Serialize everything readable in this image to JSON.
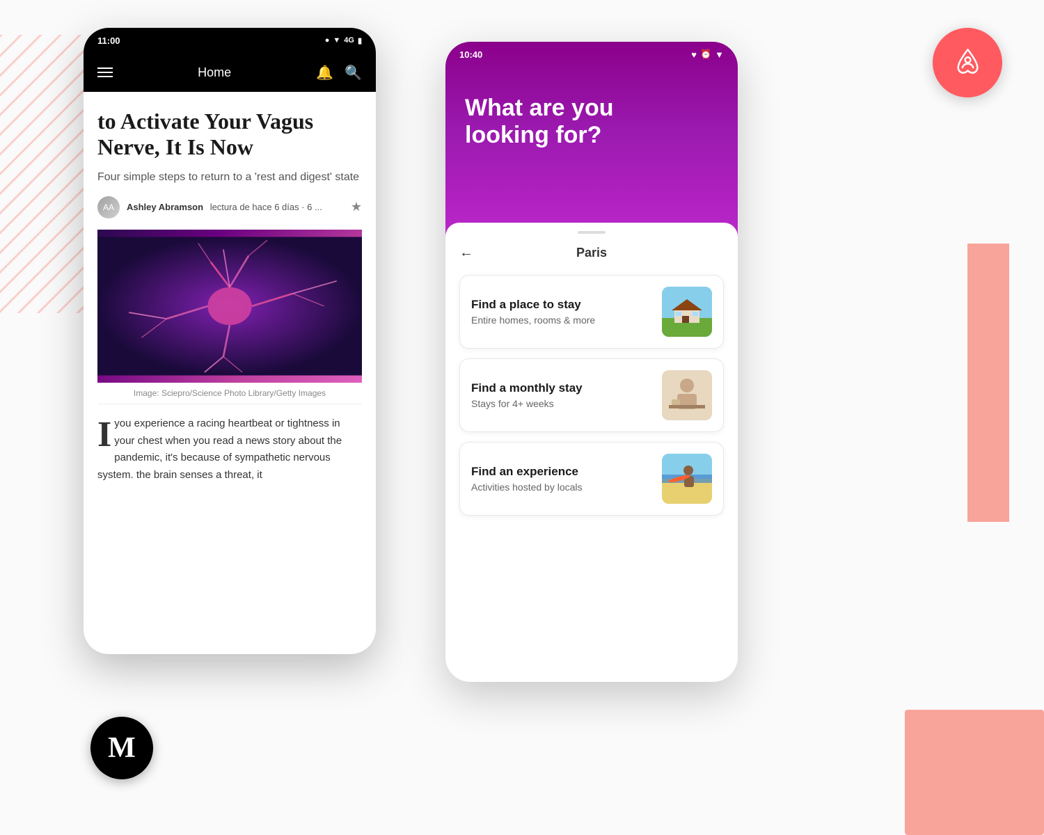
{
  "page": {
    "background_color": "#fafafa"
  },
  "medium_app": {
    "status_bar": {
      "time": "11:00",
      "icons": "● ▼ 4G ▲ 🔋"
    },
    "nav": {
      "title": "Home",
      "hamburger_icon": "menu-icon",
      "bell_icon": "notification-icon",
      "search_icon": "search-icon"
    },
    "article": {
      "title": "to Activate Your Vagus Nerve, It Is Now",
      "subtitle": "Four simple steps to return to a 'rest and digest' state",
      "author_name": "Ashley Abramson",
      "author_meta": "lectura de hace 6 días · 6 ...",
      "image_caption": "Image: Sciepro/Science Photo Library/Getty Images",
      "body_text": "you experience a racing heartbeat or tightness in your chest when you read a news story about the pandemic, it's because of sympathetic nervous system. the brain senses a threat, it",
      "drop_cap": "I",
      "star_icon": "★"
    },
    "logo": {
      "letter": "M"
    }
  },
  "airbnb_app": {
    "status_bar": {
      "time": "10:40",
      "icons": "♥ ⏰ ▼"
    },
    "header": {
      "headline_line1": "What are you",
      "headline_line2": "looking for?"
    },
    "sheet": {
      "nav_title": "Paris",
      "back_label": "←"
    },
    "options": [
      {
        "id": "place-to-stay",
        "title": "Find a place to stay",
        "subtitle": "Entire homes, rooms & more",
        "image_type": "house"
      },
      {
        "id": "monthly-stay",
        "title": "Find a monthly stay",
        "subtitle": "Stays for 4+ weeks",
        "image_type": "person"
      },
      {
        "id": "experience",
        "title": "Find an experience",
        "subtitle": "Activities hosted by locals",
        "image_type": "surfer"
      }
    ]
  },
  "airbnb_logo": {
    "brand_color": "#ff5a5f"
  },
  "decorative": {
    "pink_color": "#f9a49a",
    "diagonal_color": "#f9a49a"
  }
}
